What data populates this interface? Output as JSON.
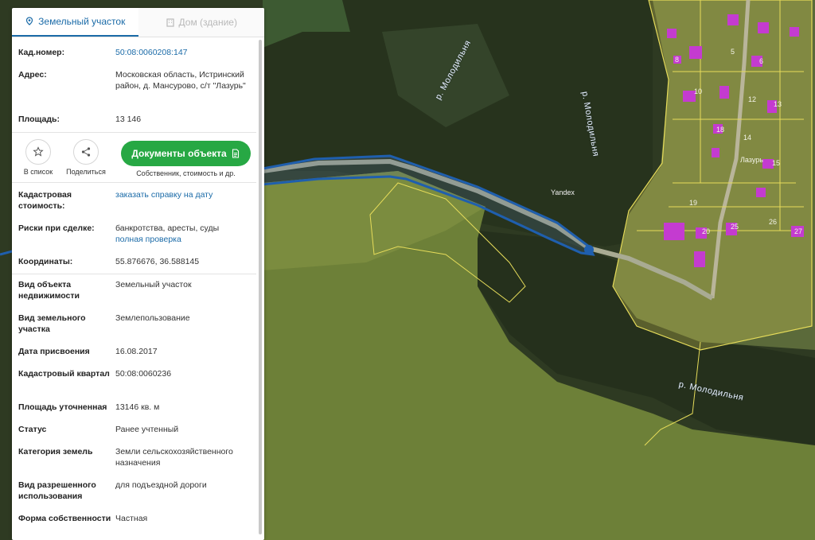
{
  "tabs": {
    "land": "Земельный участок",
    "house": "Дом (здание)"
  },
  "header_fields": [
    {
      "key": "Кад.номер:",
      "value": "50:08:0060208:147"
    },
    {
      "key": "Адрес:",
      "value": "Московская область, Истринский район, д. Мансурово, с/т \"Лазурь\""
    },
    {
      "key": "Площадь:",
      "value": "13 146"
    }
  ],
  "actions": {
    "to_list": "В список",
    "share": "Поделиться",
    "docs_button": "Документы объекта",
    "docs_sub": "Собственник, стоимость и др."
  },
  "cadastral_value": {
    "key": "Кадастровая стоимость:",
    "link": "заказать справку на дату"
  },
  "risks": {
    "key": "Риски при сделке:",
    "text": "банкротства, аресты, суды",
    "link": "полная проверка"
  },
  "coordinates": {
    "key": "Координаты:",
    "value": "55.876676, 36.588145"
  },
  "details": [
    {
      "key": "Вид объекта недвижимости",
      "value": "Земельный участок"
    },
    {
      "key": "Вид земельного участка",
      "value": "Землепользование"
    },
    {
      "key": "Дата присвоения",
      "value": "16.08.2017"
    },
    {
      "key": "Кадастровый квартал",
      "value": "50:08:0060236"
    },
    {
      "key": "Площадь уточненная",
      "value": "13146 кв. м"
    },
    {
      "key": "Статус",
      "value": "Ранее учтенный"
    },
    {
      "key": "Категория земель",
      "value": "Земли сельскохозяйственного назначения"
    },
    {
      "key": "Вид разрешенного использования",
      "value": "для подъездной дороги"
    },
    {
      "key": "Форма собственности",
      "value": "Частная"
    }
  ],
  "map": {
    "river_label": "р. Молодильня",
    "settlement_label": "Лазурь",
    "poi_label": "Yandex",
    "plot_numbers": [
      "5",
      "6",
      "8",
      "10",
      "12",
      "13",
      "14",
      "15",
      "18",
      "19",
      "20",
      "25",
      "26",
      "27"
    ],
    "colors": {
      "parcel_outline": "#1f5fae",
      "cadastre_yellow": "#e6dc5a",
      "building": "#c43bd0"
    }
  }
}
